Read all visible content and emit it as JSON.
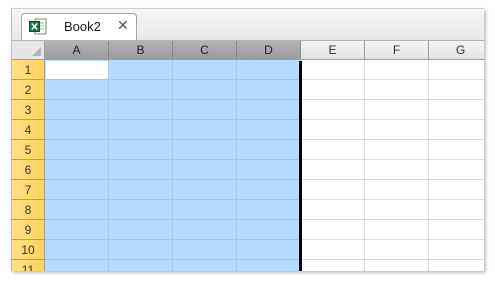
{
  "tab": {
    "title": "Book2",
    "close_glyph": "✕",
    "icon": "excel-workbook-icon"
  },
  "columns": [
    "A",
    "B",
    "C",
    "D",
    "E",
    "F",
    "G"
  ],
  "rows": [
    "1",
    "2",
    "3",
    "4",
    "5",
    "6",
    "7",
    "8",
    "9",
    "10",
    "11"
  ],
  "selection": {
    "range": "A1:D11",
    "selected_columns": [
      "A",
      "B",
      "C",
      "D"
    ],
    "active_cell": "A1"
  },
  "colors": {
    "selection_fill": "#b7dbff",
    "row_header": "#ffd25a",
    "selected_col_header": "#a8a8a8",
    "excel_green": "#1e7145"
  }
}
